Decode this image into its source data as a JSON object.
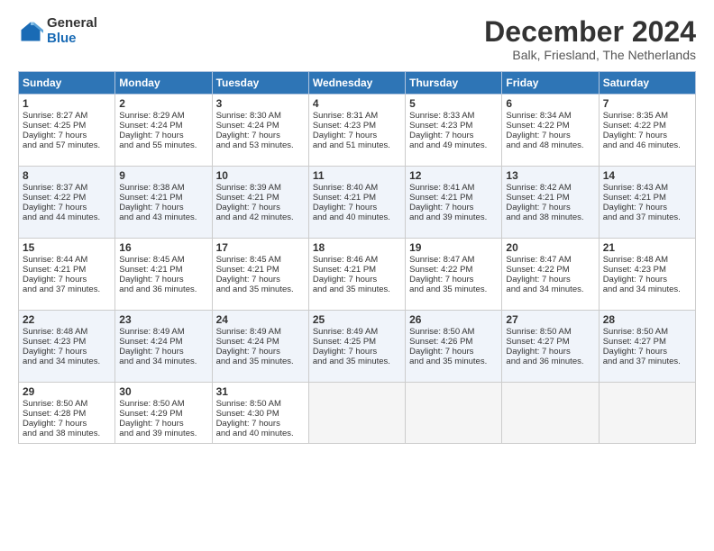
{
  "logo": {
    "general": "General",
    "blue": "Blue"
  },
  "header": {
    "title": "December 2024",
    "subtitle": "Balk, Friesland, The Netherlands"
  },
  "days": [
    "Sunday",
    "Monday",
    "Tuesday",
    "Wednesday",
    "Thursday",
    "Friday",
    "Saturday"
  ],
  "weeks": [
    [
      {
        "num": "1",
        "sunrise": "Sunrise: 8:27 AM",
        "sunset": "Sunset: 4:25 PM",
        "daylight": "Daylight: 7 hours and 57 minutes."
      },
      {
        "num": "2",
        "sunrise": "Sunrise: 8:29 AM",
        "sunset": "Sunset: 4:24 PM",
        "daylight": "Daylight: 7 hours and 55 minutes."
      },
      {
        "num": "3",
        "sunrise": "Sunrise: 8:30 AM",
        "sunset": "Sunset: 4:24 PM",
        "daylight": "Daylight: 7 hours and 53 minutes."
      },
      {
        "num": "4",
        "sunrise": "Sunrise: 8:31 AM",
        "sunset": "Sunset: 4:23 PM",
        "daylight": "Daylight: 7 hours and 51 minutes."
      },
      {
        "num": "5",
        "sunrise": "Sunrise: 8:33 AM",
        "sunset": "Sunset: 4:23 PM",
        "daylight": "Daylight: 7 hours and 49 minutes."
      },
      {
        "num": "6",
        "sunrise": "Sunrise: 8:34 AM",
        "sunset": "Sunset: 4:22 PM",
        "daylight": "Daylight: 7 hours and 48 minutes."
      },
      {
        "num": "7",
        "sunrise": "Sunrise: 8:35 AM",
        "sunset": "Sunset: 4:22 PM",
        "daylight": "Daylight: 7 hours and 46 minutes."
      }
    ],
    [
      {
        "num": "8",
        "sunrise": "Sunrise: 8:37 AM",
        "sunset": "Sunset: 4:22 PM",
        "daylight": "Daylight: 7 hours and 44 minutes."
      },
      {
        "num": "9",
        "sunrise": "Sunrise: 8:38 AM",
        "sunset": "Sunset: 4:21 PM",
        "daylight": "Daylight: 7 hours and 43 minutes."
      },
      {
        "num": "10",
        "sunrise": "Sunrise: 8:39 AM",
        "sunset": "Sunset: 4:21 PM",
        "daylight": "Daylight: 7 hours and 42 minutes."
      },
      {
        "num": "11",
        "sunrise": "Sunrise: 8:40 AM",
        "sunset": "Sunset: 4:21 PM",
        "daylight": "Daylight: 7 hours and 40 minutes."
      },
      {
        "num": "12",
        "sunrise": "Sunrise: 8:41 AM",
        "sunset": "Sunset: 4:21 PM",
        "daylight": "Daylight: 7 hours and 39 minutes."
      },
      {
        "num": "13",
        "sunrise": "Sunrise: 8:42 AM",
        "sunset": "Sunset: 4:21 PM",
        "daylight": "Daylight: 7 hours and 38 minutes."
      },
      {
        "num": "14",
        "sunrise": "Sunrise: 8:43 AM",
        "sunset": "Sunset: 4:21 PM",
        "daylight": "Daylight: 7 hours and 37 minutes."
      }
    ],
    [
      {
        "num": "15",
        "sunrise": "Sunrise: 8:44 AM",
        "sunset": "Sunset: 4:21 PM",
        "daylight": "Daylight: 7 hours and 37 minutes."
      },
      {
        "num": "16",
        "sunrise": "Sunrise: 8:45 AM",
        "sunset": "Sunset: 4:21 PM",
        "daylight": "Daylight: 7 hours and 36 minutes."
      },
      {
        "num": "17",
        "sunrise": "Sunrise: 8:45 AM",
        "sunset": "Sunset: 4:21 PM",
        "daylight": "Daylight: 7 hours and 35 minutes."
      },
      {
        "num": "18",
        "sunrise": "Sunrise: 8:46 AM",
        "sunset": "Sunset: 4:21 PM",
        "daylight": "Daylight: 7 hours and 35 minutes."
      },
      {
        "num": "19",
        "sunrise": "Sunrise: 8:47 AM",
        "sunset": "Sunset: 4:22 PM",
        "daylight": "Daylight: 7 hours and 35 minutes."
      },
      {
        "num": "20",
        "sunrise": "Sunrise: 8:47 AM",
        "sunset": "Sunset: 4:22 PM",
        "daylight": "Daylight: 7 hours and 34 minutes."
      },
      {
        "num": "21",
        "sunrise": "Sunrise: 8:48 AM",
        "sunset": "Sunset: 4:23 PM",
        "daylight": "Daylight: 7 hours and 34 minutes."
      }
    ],
    [
      {
        "num": "22",
        "sunrise": "Sunrise: 8:48 AM",
        "sunset": "Sunset: 4:23 PM",
        "daylight": "Daylight: 7 hours and 34 minutes."
      },
      {
        "num": "23",
        "sunrise": "Sunrise: 8:49 AM",
        "sunset": "Sunset: 4:24 PM",
        "daylight": "Daylight: 7 hours and 34 minutes."
      },
      {
        "num": "24",
        "sunrise": "Sunrise: 8:49 AM",
        "sunset": "Sunset: 4:24 PM",
        "daylight": "Daylight: 7 hours and 35 minutes."
      },
      {
        "num": "25",
        "sunrise": "Sunrise: 8:49 AM",
        "sunset": "Sunset: 4:25 PM",
        "daylight": "Daylight: 7 hours and 35 minutes."
      },
      {
        "num": "26",
        "sunrise": "Sunrise: 8:50 AM",
        "sunset": "Sunset: 4:26 PM",
        "daylight": "Daylight: 7 hours and 35 minutes."
      },
      {
        "num": "27",
        "sunrise": "Sunrise: 8:50 AM",
        "sunset": "Sunset: 4:27 PM",
        "daylight": "Daylight: 7 hours and 36 minutes."
      },
      {
        "num": "28",
        "sunrise": "Sunrise: 8:50 AM",
        "sunset": "Sunset: 4:27 PM",
        "daylight": "Daylight: 7 hours and 37 minutes."
      }
    ],
    [
      {
        "num": "29",
        "sunrise": "Sunrise: 8:50 AM",
        "sunset": "Sunset: 4:28 PM",
        "daylight": "Daylight: 7 hours and 38 minutes."
      },
      {
        "num": "30",
        "sunrise": "Sunrise: 8:50 AM",
        "sunset": "Sunset: 4:29 PM",
        "daylight": "Daylight: 7 hours and 39 minutes."
      },
      {
        "num": "31",
        "sunrise": "Sunrise: 8:50 AM",
        "sunset": "Sunset: 4:30 PM",
        "daylight": "Daylight: 7 hours and 40 minutes."
      },
      null,
      null,
      null,
      null
    ]
  ]
}
